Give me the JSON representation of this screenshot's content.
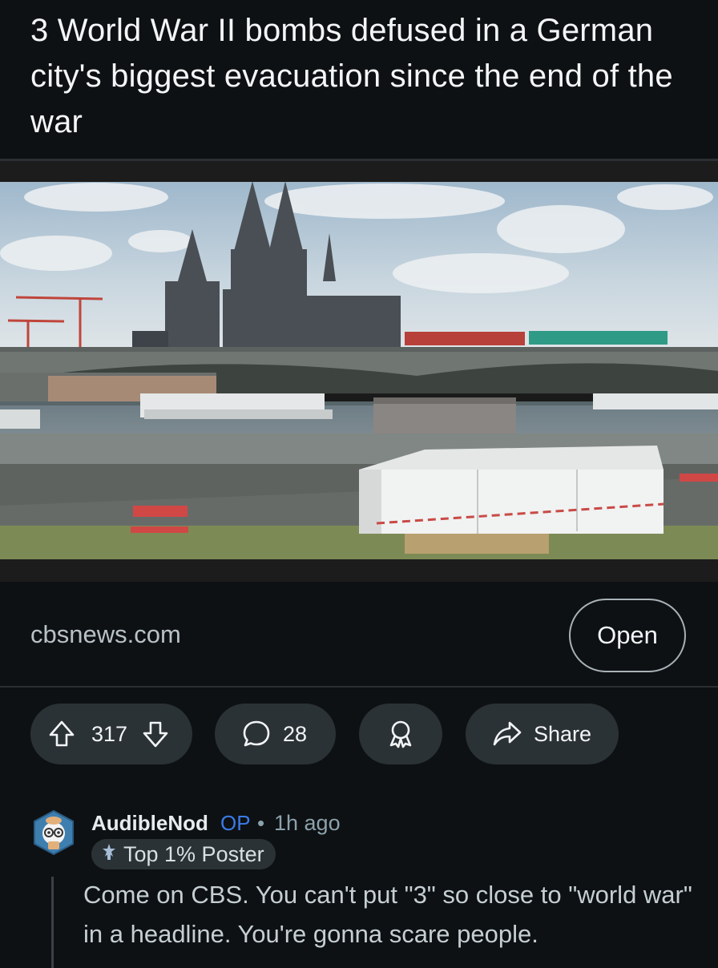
{
  "post": {
    "title": "3 World War II bombs defused in a German city's biggest evacuation since the end of the war"
  },
  "link": {
    "domain": "cbsnews.com",
    "open_label": "Open"
  },
  "actions": {
    "vote_count": "317",
    "comment_count": "28",
    "share_label": "Share"
  },
  "comment": {
    "username": "AudibleNod",
    "op_label": "OP",
    "separator": "•",
    "time": "1h ago",
    "flair": "Top 1% Poster",
    "body": "Come on CBS. You can't put \"3\" so close to \"world war\" in a headline. You're gonna scare people."
  },
  "colors": {
    "background": "#0e1113",
    "pill": "#2a3236",
    "op_accent": "#3b7be8",
    "muted_text": "#8ba2ad"
  },
  "icons": [
    "upvote-icon",
    "downvote-icon",
    "comment-icon",
    "award-icon",
    "share-icon",
    "avatar-icon",
    "flair-icon"
  ]
}
